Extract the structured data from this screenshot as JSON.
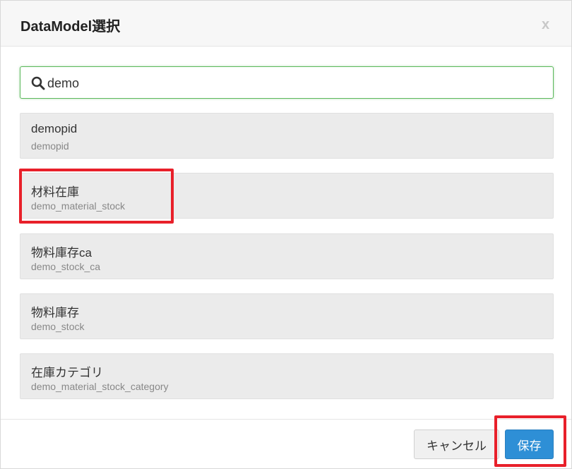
{
  "dialog": {
    "title": "DataModel選択",
    "close_label": "x"
  },
  "search": {
    "icon": "search-icon",
    "value": "demo"
  },
  "items": [
    {
      "name": "demopid",
      "id": "demopid"
    },
    {
      "name": "材料在庫",
      "id": "demo_material_stock"
    },
    {
      "name": "物料庫存ca",
      "id": "demo_stock_ca"
    },
    {
      "name": "物料庫存",
      "id": "demo_stock"
    },
    {
      "name": "在庫カテゴリ",
      "id": "demo_material_stock_category"
    }
  ],
  "footer": {
    "cancel_label": "キャンセル",
    "save_label": "保存"
  },
  "colors": {
    "accent": "#2e8fd6",
    "search_border": "#5cb85c",
    "highlight": "#e8202a"
  }
}
